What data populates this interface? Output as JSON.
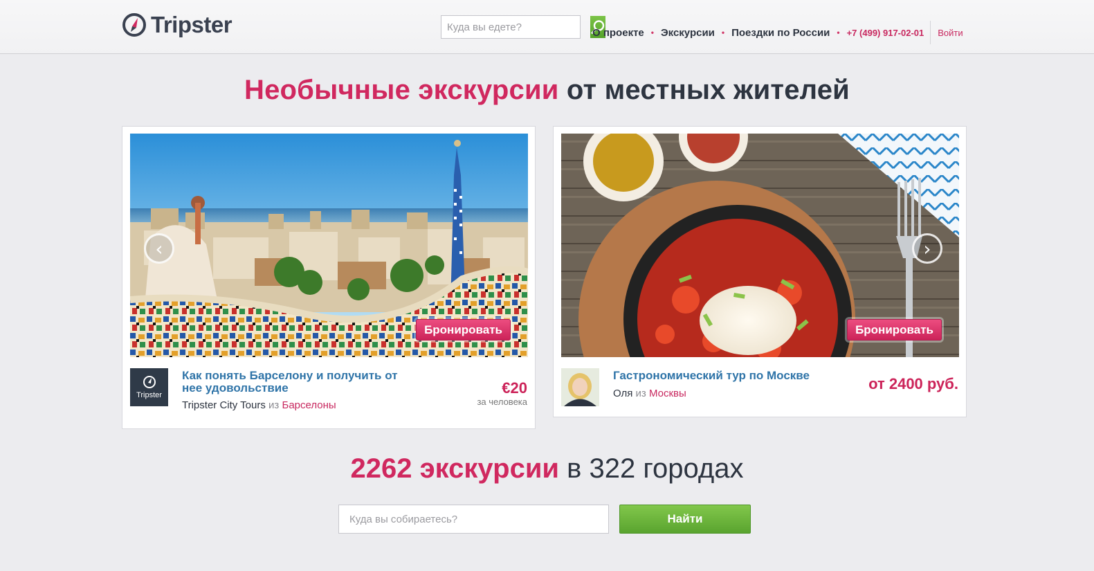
{
  "header": {
    "logo_text": "Tripster",
    "search_placeholder": "Куда вы едете?",
    "nav": {
      "about": "О проекте",
      "excursions": "Экскурсии",
      "russia_trips": "Поездки по России",
      "phone": "+7 (499) 917-02-01",
      "login": "Войти"
    }
  },
  "hero": {
    "title_accent": "Необычные экскурсии",
    "title_rest": " от местных жителей"
  },
  "cards": [
    {
      "book_label": "Бронировать",
      "title": "Как понять Барселону и получить от нее удовольствие",
      "operator": "Tripster City Tours",
      "from_word": "из",
      "city": "Барселоны",
      "price": "€20",
      "price_note": "за человека",
      "avatar_label": "Tripster",
      "arrow": "‹"
    },
    {
      "book_label": "Бронировать",
      "title": "Гастрономический тур по Москве",
      "operator": "Оля",
      "from_word": "из",
      "city": "Москвы",
      "price": "от 2400 руб.",
      "arrow": "›"
    }
  ],
  "stats": {
    "count_accent": "2262 экскурсии",
    "rest": " в 322 городах"
  },
  "bottom_search": {
    "placeholder": "Куда вы собираетесь?",
    "button": "Найти"
  },
  "colors": {
    "accent": "#d0285f",
    "link": "#2f74a8",
    "green": "#5aa42f"
  },
  "icons": {
    "logo": "compass-icon",
    "search": "magnifier-icon",
    "prev": "chevron-left-icon",
    "next": "chevron-right-icon"
  }
}
